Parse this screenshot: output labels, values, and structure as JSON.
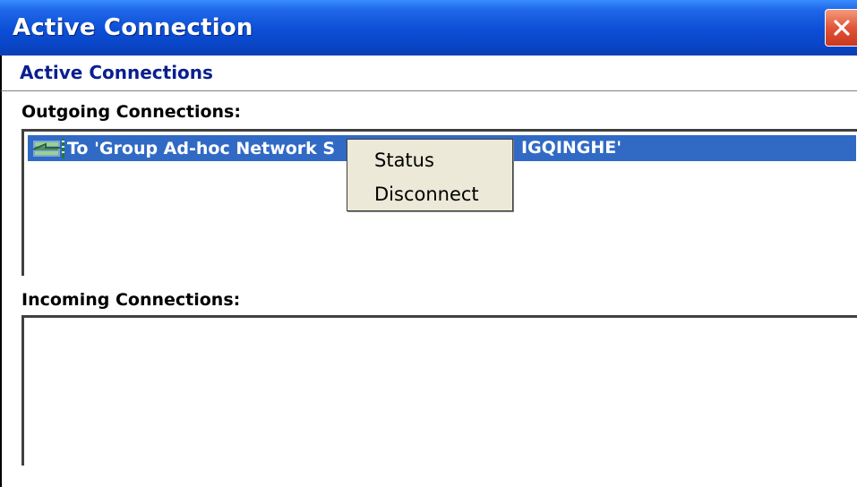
{
  "window": {
    "title": "Active Connection",
    "close_icon": "close-icon"
  },
  "header": {
    "title": "Active Connections"
  },
  "outgoing": {
    "label": "Outgoing Connections:",
    "items": [
      {
        "icon": "network-connection-icon",
        "text": "To 'Group Ad-hoc Network S",
        "text_tail": "IGQINGHE'",
        "selected": true
      }
    ]
  },
  "incoming": {
    "label": "Incoming Connections:",
    "items": []
  },
  "context_menu": {
    "items": [
      {
        "label": "Status"
      },
      {
        "label": "Disconnect"
      }
    ]
  },
  "colors": {
    "titlebar": "#0c4ed6",
    "selection": "#316ac5",
    "header_text": "#0a1f8f",
    "menu_bg": "#ece9d8",
    "close_button": "#e2553a"
  }
}
